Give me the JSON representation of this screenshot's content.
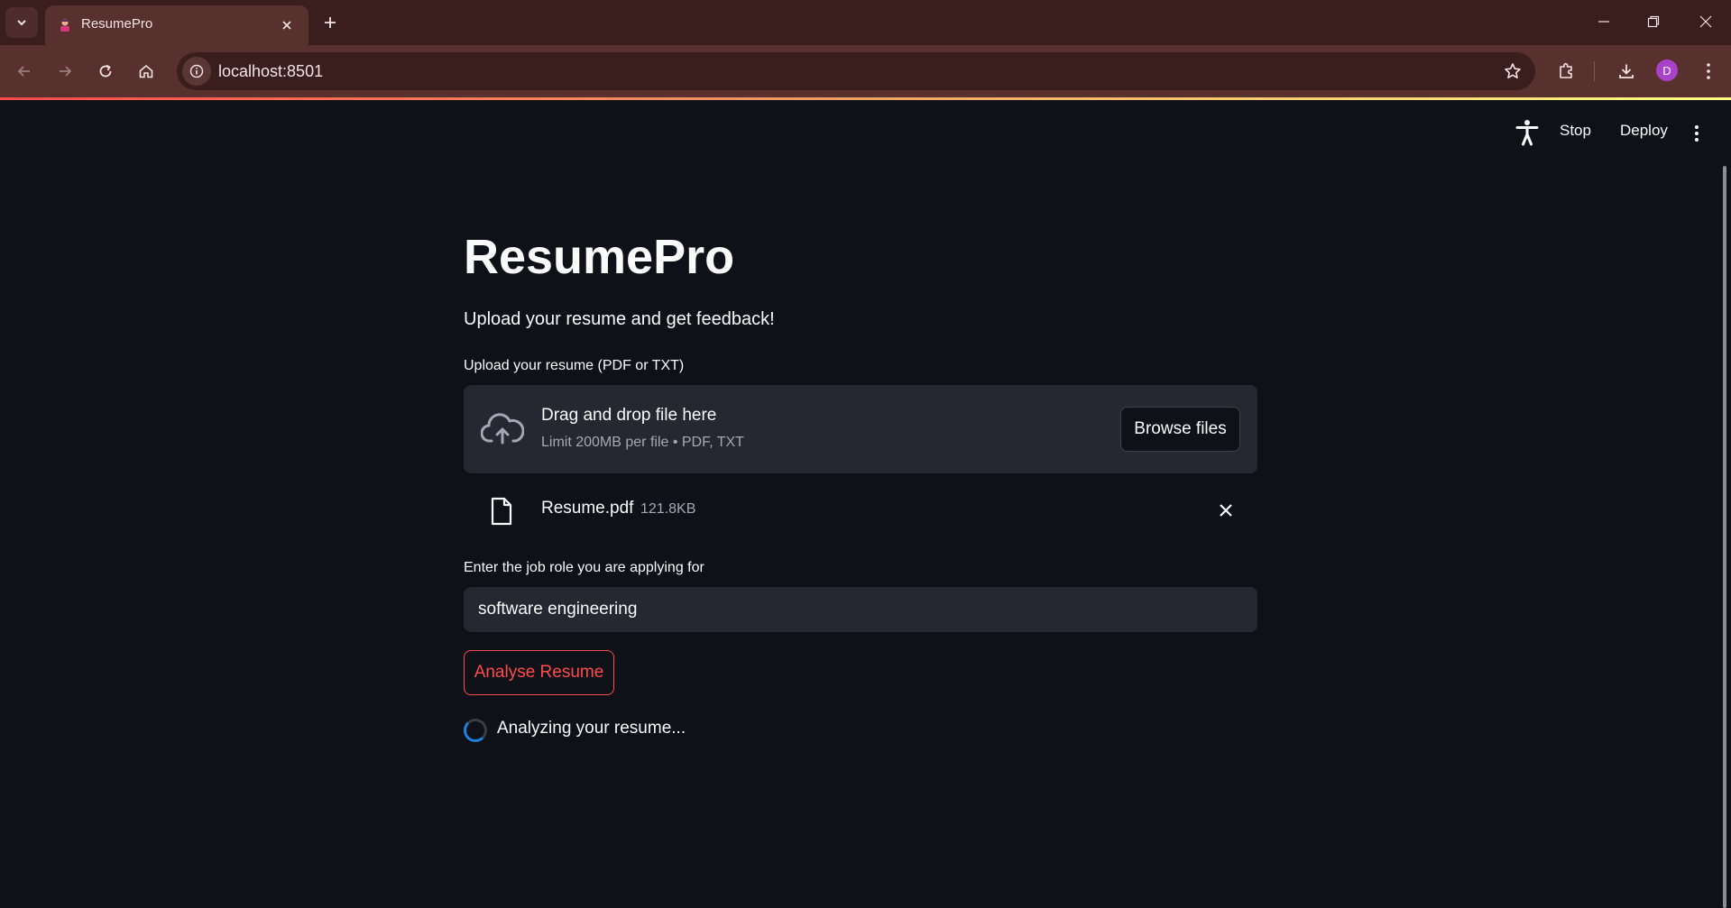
{
  "browser": {
    "tab_title": "ResumePro",
    "url": "localhost:8501",
    "profile_initial": "D"
  },
  "app_header": {
    "stop_label": "Stop",
    "deploy_label": "Deploy"
  },
  "main": {
    "title": "ResumePro",
    "subtitle": "Upload your resume and get feedback!",
    "uploader": {
      "label": "Upload your resume (PDF or TXT)",
      "drop_text": "Drag and drop file here",
      "limit_text": "Limit 200MB per file • PDF, TXT",
      "browse_label": "Browse files"
    },
    "uploaded_file": {
      "name": "Resume.pdf",
      "size": "121.8KB"
    },
    "job_role": {
      "label": "Enter the job role you are applying for",
      "value": "software engineering"
    },
    "analyse_label": "Analyse Resume",
    "status_text": "Analyzing your resume..."
  },
  "colors": {
    "background": "#0e1117",
    "accent": "#ff4b4b",
    "spinner": "#1c83e1",
    "chrome_frame": "#3a1e1e",
    "chrome_toolbar": "#58302e"
  }
}
